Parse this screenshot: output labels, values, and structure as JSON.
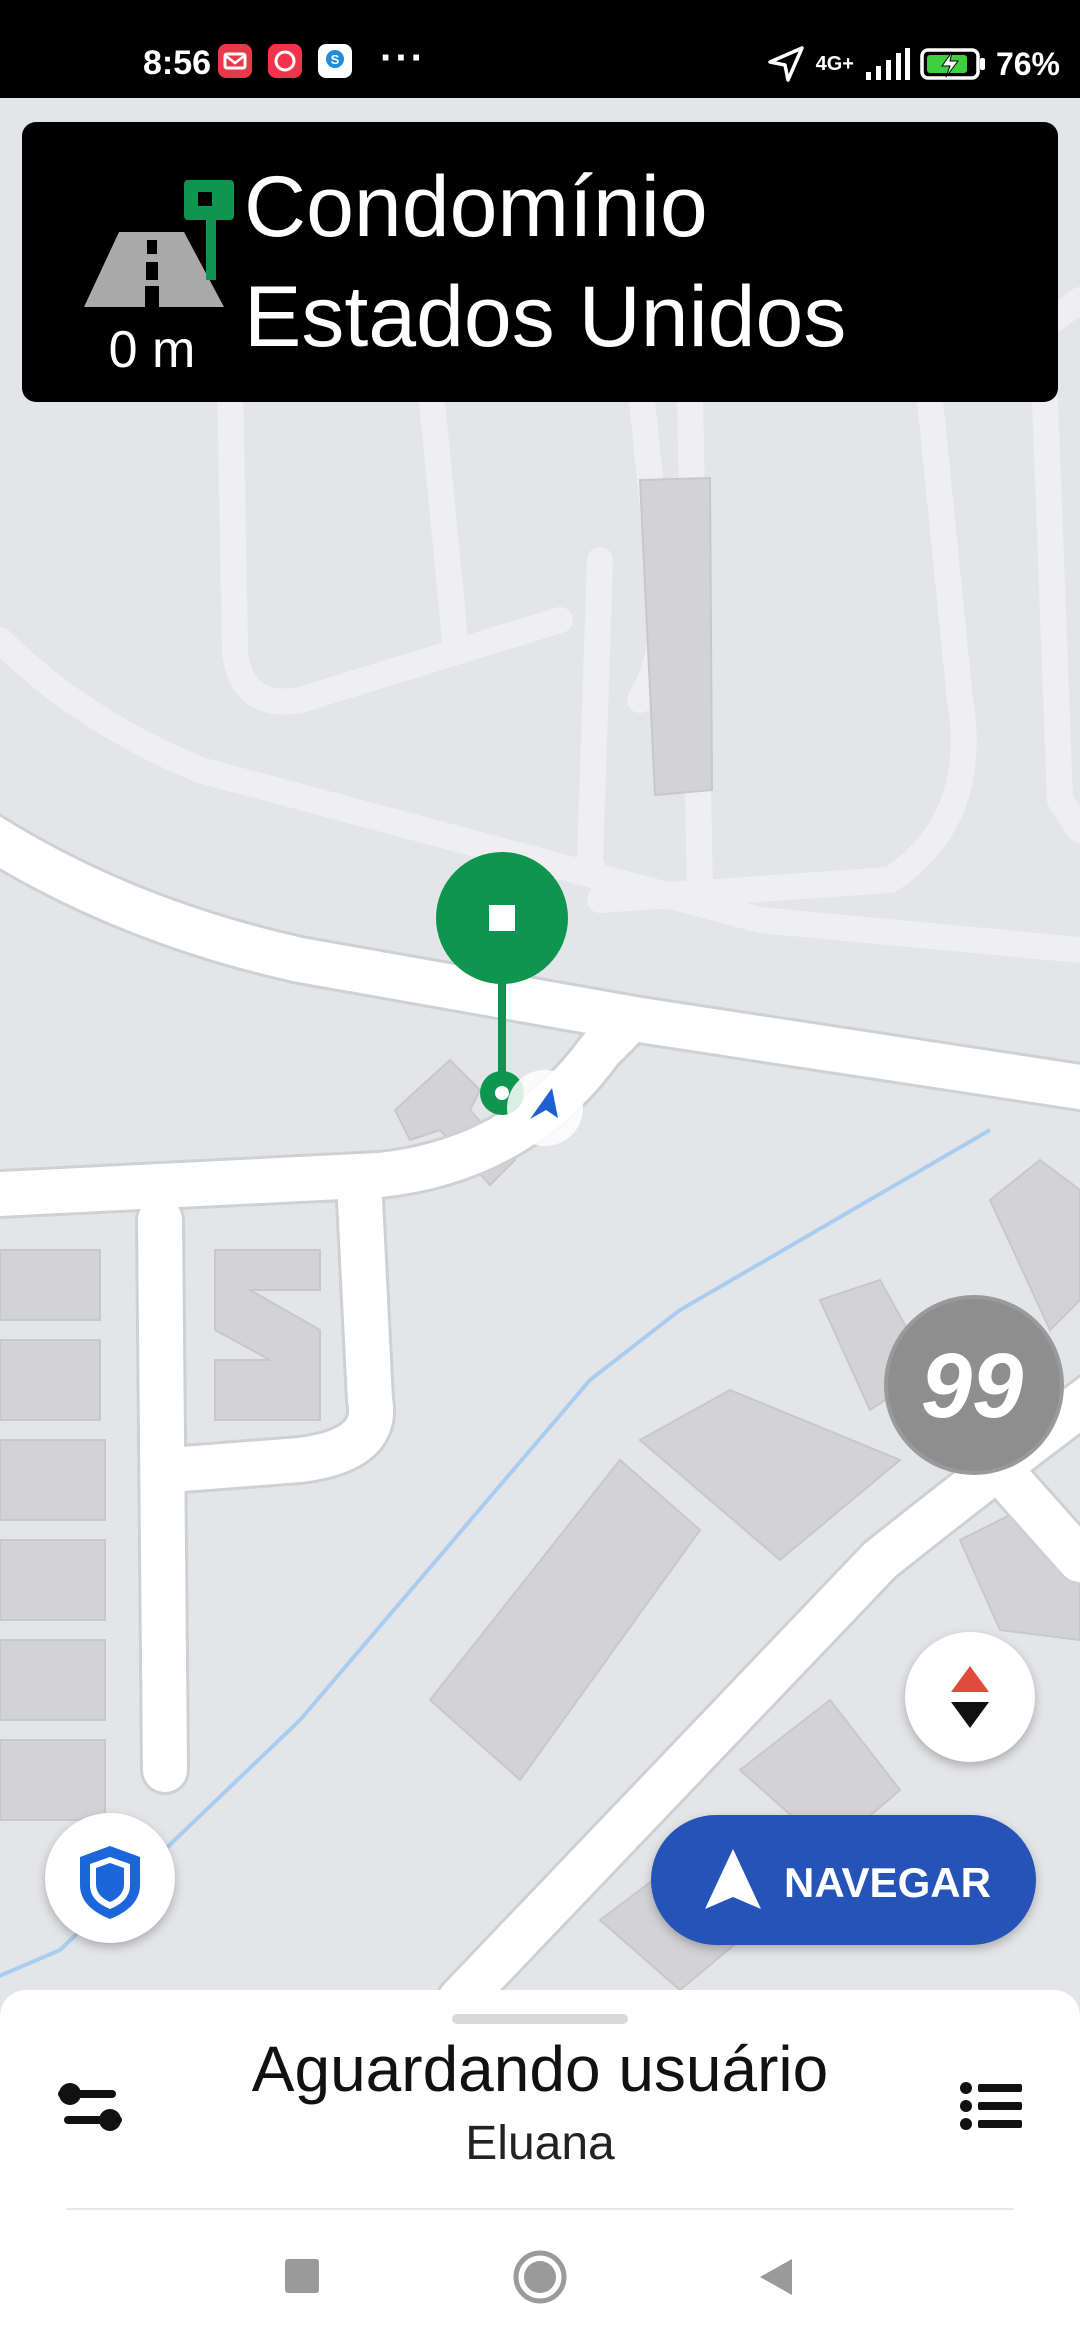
{
  "status_bar": {
    "time": "8:56",
    "network": "4G+",
    "battery": "76%",
    "more": "···"
  },
  "banner": {
    "distance": "0 m",
    "destination_line1": "Condomínio",
    "destination_line2": "Estados Unidos",
    "maneuver_icon": "arrive-destination-icon"
  },
  "map": {
    "badge_text": "99",
    "pin_color": "#0e9650",
    "route_color": "#9ec9f2"
  },
  "navigate_button": {
    "label": "NAVEGAR",
    "color": "#2553b8"
  },
  "bottom_sheet": {
    "status": "Aguardando usuário",
    "name": "Eluana"
  },
  "colors": {
    "accent_red": "#e14b3b",
    "shield_blue": "#1b66d8"
  }
}
